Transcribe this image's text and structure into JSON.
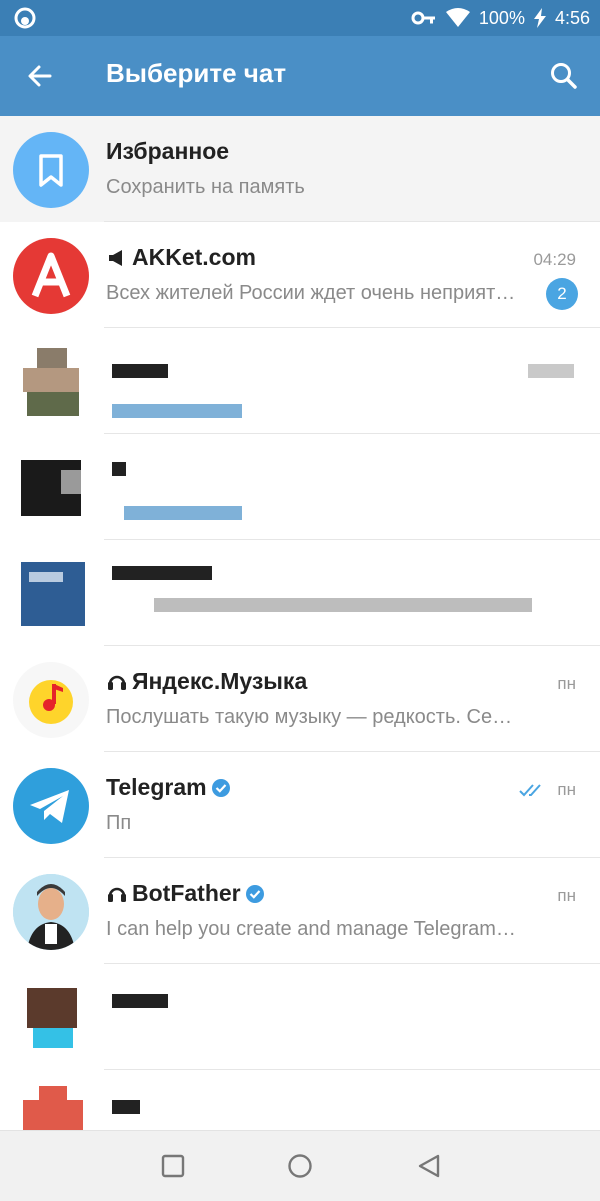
{
  "status_bar": {
    "battery": "100%",
    "time": "4:56"
  },
  "app_bar": {
    "title": "Выберите чат",
    "back_icon": "arrow-left-icon",
    "search_icon": "search-icon"
  },
  "chats": [
    {
      "id": "saved",
      "name": "Избранное",
      "preview": "Сохранить на память",
      "time": "",
      "badge": "",
      "avatar_color": "#64b5f6"
    },
    {
      "id": "akket",
      "name": "AKKet.com",
      "preview": "Всех жителей России ждет очень неприятный сюрприз",
      "time": "04:29",
      "badge": "2",
      "avatar_color": "#e53935",
      "avatar_letter": "A"
    },
    {
      "id": "yandex",
      "name": "Яндекс.Музыка",
      "preview": "Послушать такую музыку — редкость. Сегодня",
      "time": "пн",
      "badge": ""
    },
    {
      "id": "telegram",
      "name": "Telegram",
      "preview": "Пп",
      "time": "пн",
      "badge": ""
    },
    {
      "id": "botfather",
      "name": "BotFather",
      "preview": "I can help you create and manage Telegram bots",
      "time": "пн",
      "badge": ""
    }
  ],
  "colors": {
    "status_bar": "#3b7fb5",
    "app_bar": "#4a8fc6",
    "badge": "#4aa5e2",
    "verified": "#3d9be0"
  }
}
